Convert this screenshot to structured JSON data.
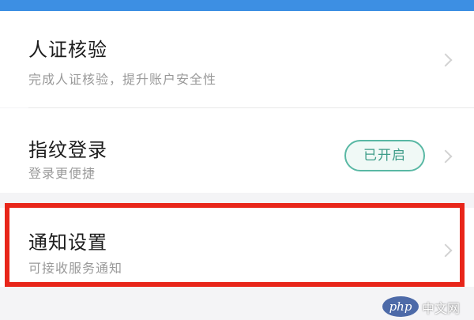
{
  "settings": {
    "items": [
      {
        "title": "人证核验",
        "subtitle": "完成人证核验，提升账户安全性"
      },
      {
        "title": "指纹登录",
        "subtitle": "登录更便捷",
        "status_badge": "已开启"
      },
      {
        "title": "通知设置",
        "subtitle": "可接收服务通知"
      }
    ]
  },
  "watermark": {
    "logo": "php",
    "text": "中文网"
  },
  "colors": {
    "top_bar": "#3d8fe3",
    "badge_border": "#59b8a4",
    "badge_text": "#3d9c88",
    "highlight_border": "#e8261a"
  }
}
